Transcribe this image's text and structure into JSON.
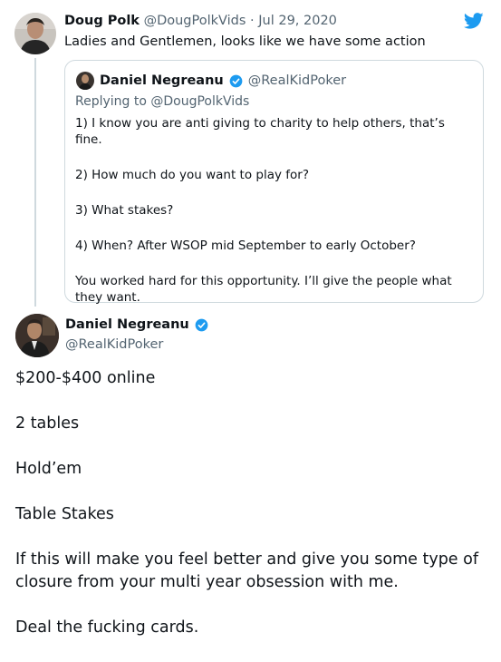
{
  "brand": {
    "twitter_blue": "#1d9bf0",
    "text_color": "#0f1419",
    "muted_color": "#536471",
    "border_color": "#cfd9de"
  },
  "icons": {
    "logo": "twitter-bird-icon",
    "verified": "verified-badge-icon"
  },
  "top_tweet": {
    "name": "Doug Polk",
    "handle": "@DougPolkVids",
    "separator": "·",
    "date": "Jul 29, 2020",
    "text": "Ladies and Gentlemen, looks like we have some action"
  },
  "quoted_tweet": {
    "name": "Daniel Negreanu",
    "handle": "@RealKidPoker",
    "replying_to": "Replying to @DougPolkVids",
    "paragraphs": [
      "1) I know you are anti giving to charity to help others, that’s fine.",
      "2) How much do you want to play for?",
      "3) What stakes?",
      "4) When? After WSOP mid September to early October?",
      "You worked hard for this opportunity. I’ll give the people what they want."
    ]
  },
  "main_tweet": {
    "name": "Daniel Negreanu",
    "handle": "@RealKidPoker",
    "paragraphs": [
      "$200-$400 online",
      "2 tables",
      "Hold’em",
      "Table Stakes",
      "If this will make you feel better and give you some type of closure from your multi year obsession with me.",
      "Deal the fucking cards."
    ]
  }
}
